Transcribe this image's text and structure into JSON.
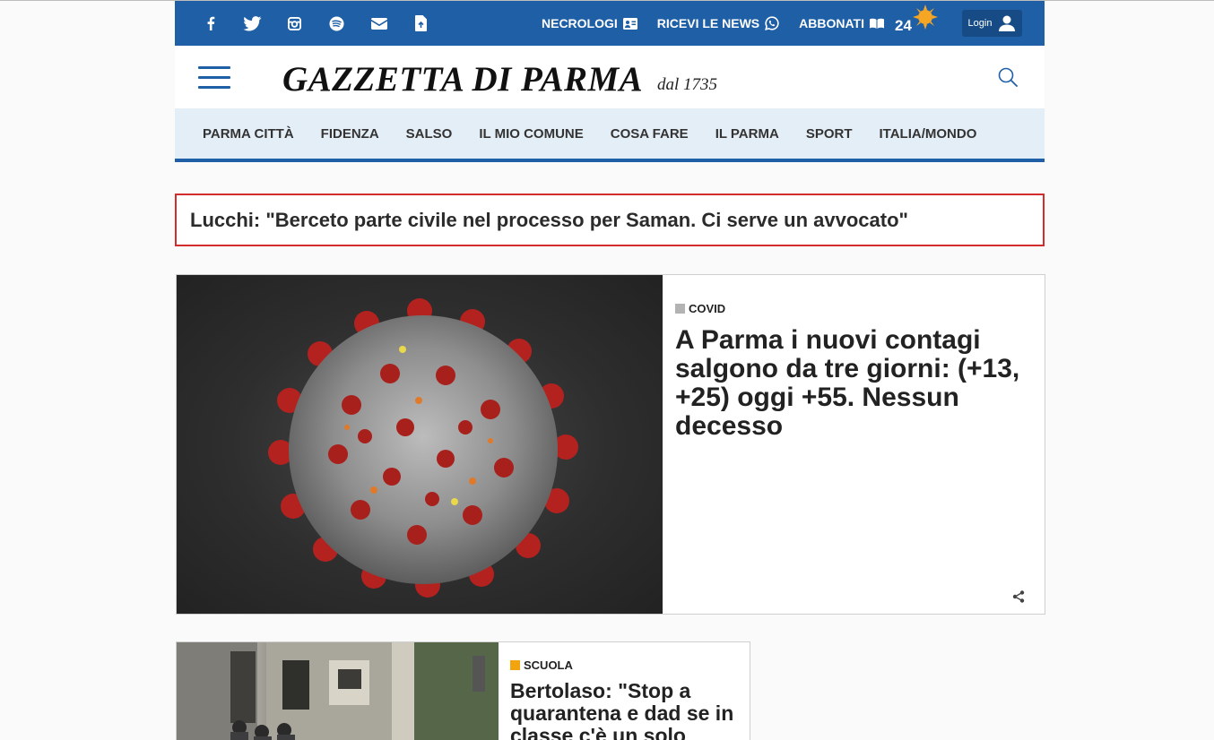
{
  "topbar": {
    "social": [
      {
        "icon": "facebook-icon"
      },
      {
        "icon": "twitter-icon"
      },
      {
        "icon": "instagram-icon"
      },
      {
        "icon": "spotify-icon"
      },
      {
        "icon": "mail-icon"
      },
      {
        "icon": "app-download-icon"
      }
    ],
    "links": [
      {
        "label": "NECROLOGI",
        "icon": "necrologi-card-icon"
      },
      {
        "label": "RICEVI LE NEWS",
        "icon": "whatsapp-icon"
      },
      {
        "label": "ABBONATI",
        "icon": "open-book-icon"
      }
    ],
    "weather": {
      "temp": "24",
      "icon": "sun-icon"
    },
    "login": {
      "label": "Login",
      "icon": "user-icon"
    }
  },
  "masthead": {
    "logo": "GAZZETTA DI PARMA",
    "since": "dal 1735"
  },
  "nav": [
    "PARMA CITTÀ",
    "FIDENZA",
    "SALSO",
    "IL MIO COMUNE",
    "COSA FARE",
    "IL PARMA",
    "SPORT",
    "ITALIA/MONDO"
  ],
  "breaking": "Lucchi: \"Berceto parte civile nel processo per Saman. Ci serve un avvocato\"",
  "articles": [
    {
      "category": "COVID",
      "category_color": "#b3b3b3",
      "title": "A Parma i nuovi contagi salgono da tre giorni: (+13, +25) oggi +55. Nessun decesso"
    },
    {
      "category": "SCUOLA",
      "category_color": "#f2a40f",
      "title": "Bertolaso: \"Stop a quarantena e dad se in classe c'è un solo"
    }
  ],
  "colors": {
    "brand": "#1f5fa6",
    "breaking_border": "#d32c2c",
    "nav_bg": "#e4eef7"
  }
}
